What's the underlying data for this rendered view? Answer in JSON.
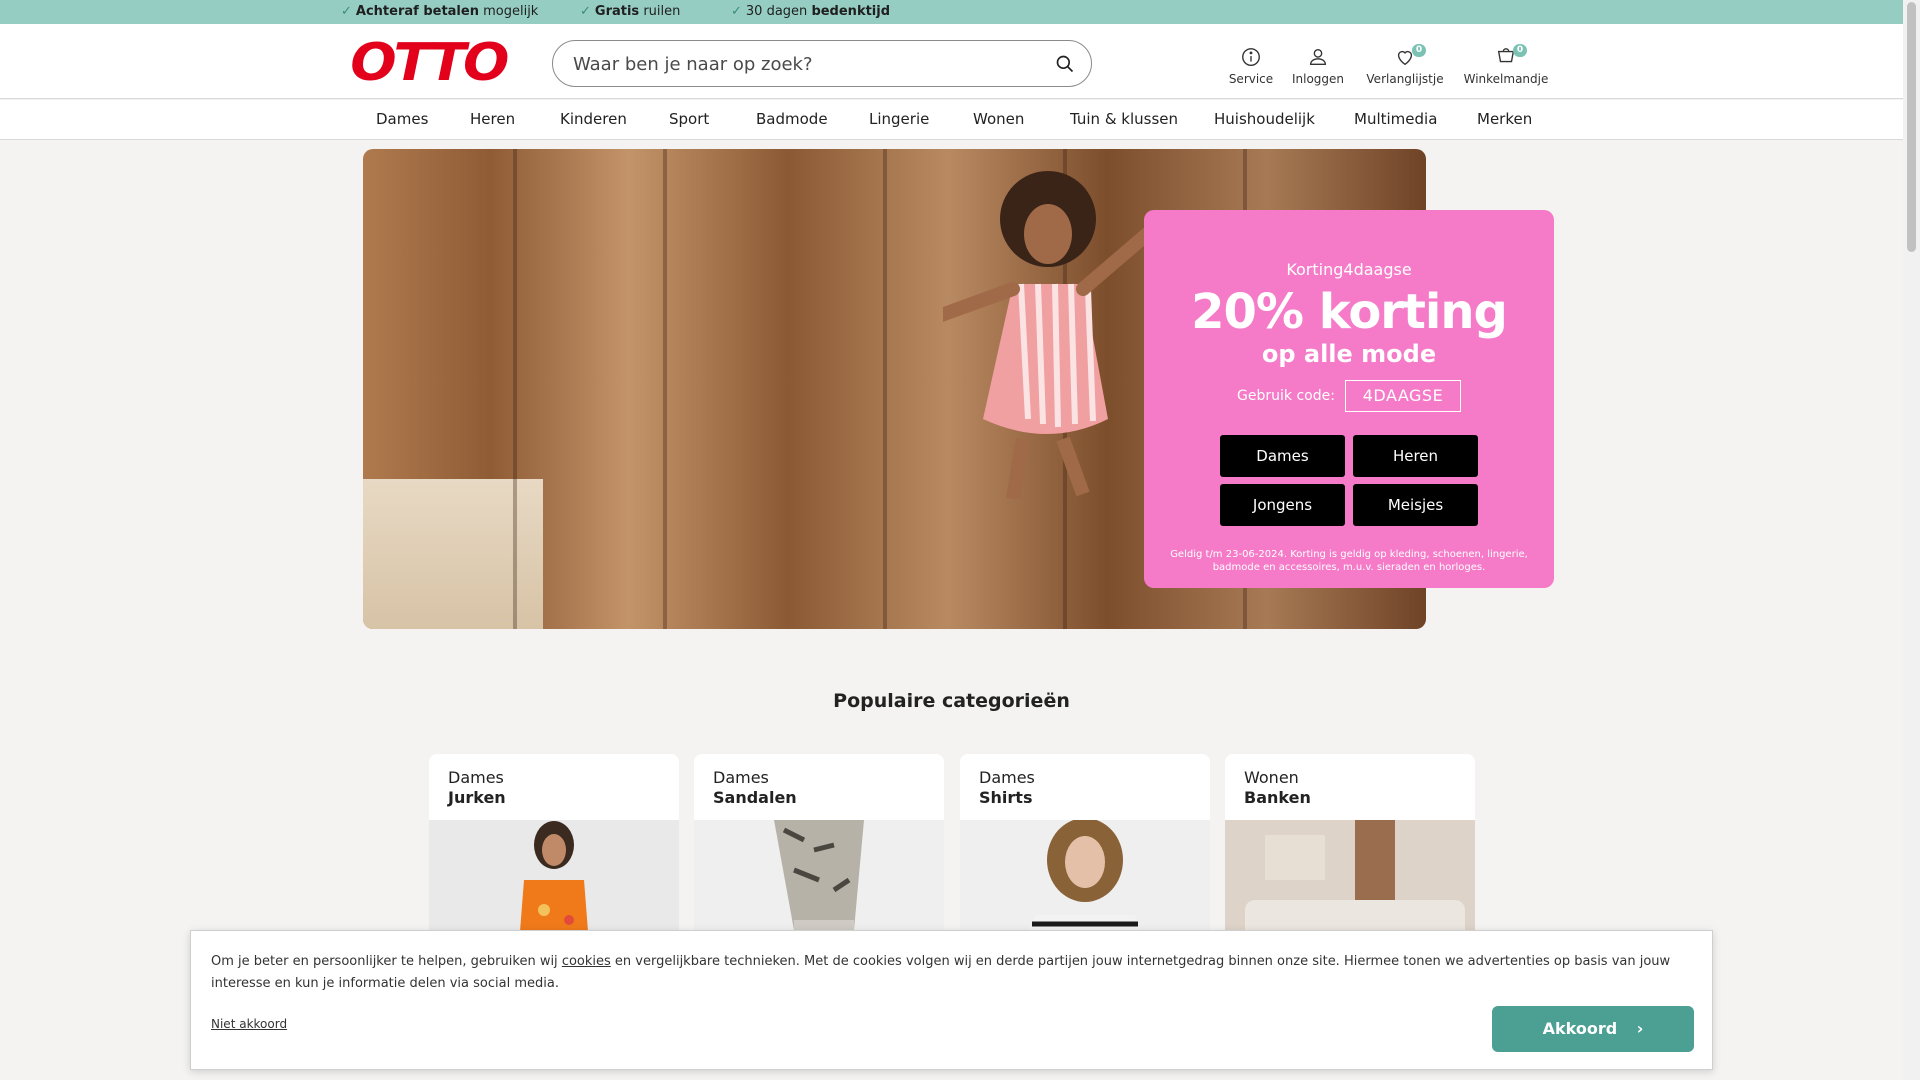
{
  "usp_bar": {
    "items": [
      {
        "bold": "Achteraf betalen",
        "rest": "mogelijk"
      },
      {
        "bold": "Gratis",
        "rest": "ruilen"
      },
      {
        "bold": "bedenktijd",
        "prefix": "30 dagen"
      }
    ]
  },
  "header": {
    "logo": "OTTO",
    "search_placeholder": "Waar ben je naar op zoek?",
    "service": "Service",
    "login": "Inloggen",
    "wishlist": "Verlanglijstje",
    "wishlist_count": "0",
    "cart": "Winkelmandje",
    "cart_count": "0"
  },
  "nav": {
    "items": [
      "Dames",
      "Heren",
      "Kinderen",
      "Sport",
      "Badmode",
      "Lingerie",
      "Wonen",
      "Tuin & klussen",
      "Huishoudelijk",
      "Multimedia",
      "Merken"
    ]
  },
  "promo": {
    "eyebrow": "Korting4daagse",
    "headline": "20% korting",
    "sub": "op alle mode",
    "code_label": "Gebruik code:",
    "code": "4DAAGSE",
    "buttons": [
      "Dames",
      "Heren",
      "Jongens",
      "Meisjes"
    ],
    "fine_print": "Geldig t/m 23-06-2024. Korting is geldig op kleding, schoenen, lingerie, badmode en accessoires, m.u.v. sieraden en horloges."
  },
  "popular": {
    "title": "Populaire categorieën",
    "cards": [
      {
        "top": "Dames",
        "bottom": "Jurken"
      },
      {
        "top": "Dames",
        "bottom": "Sandalen"
      },
      {
        "top": "Dames",
        "bottom": "Shirts"
      },
      {
        "top": "Wonen",
        "bottom": "Banken"
      }
    ]
  },
  "cookie": {
    "text_before": "Om je beter en persoonlijker te helpen, gebruiken wij",
    "link": "cookies",
    "text_after": "en vergelijkbare technieken. Met de cookies volgen wij en derde partijen jouw internetgedrag binnen onze site. Hiermee tonen we advertenties op basis van jouw interesse en kun je informatie delen via social media.",
    "decline": "Niet akkoord",
    "accept": "Akkoord"
  },
  "colors": {
    "brand_red": "#e2001a",
    "usp_teal": "#95cdc3",
    "promo_pink": "#f57bc8",
    "accept_teal": "#4b9f93"
  }
}
